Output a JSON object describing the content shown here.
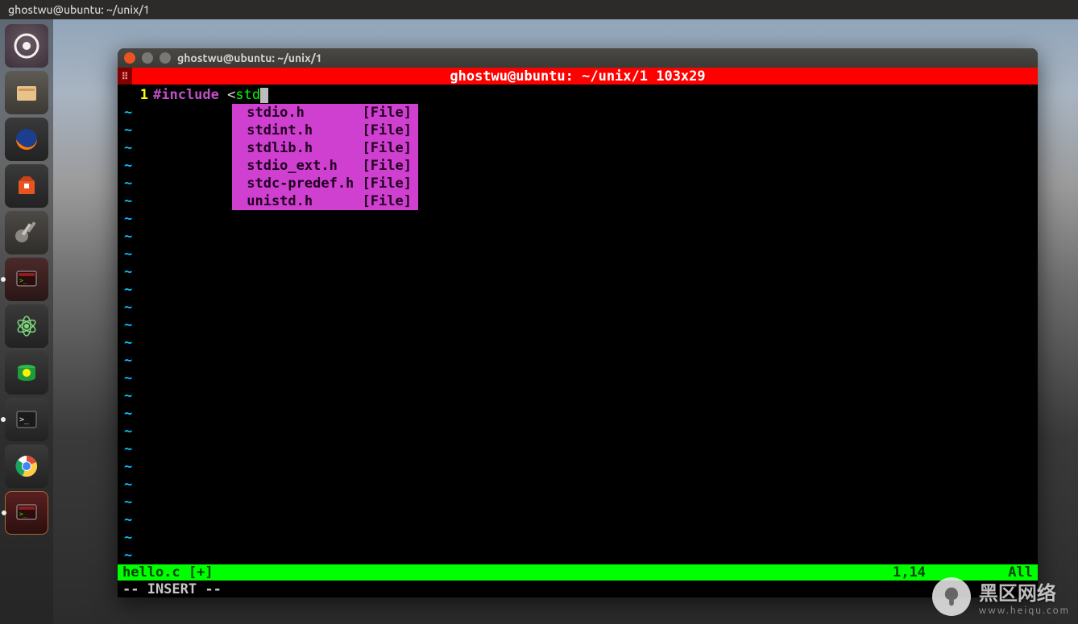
{
  "topbar": {
    "title": "ghostwu@ubuntu: ~/unix/1"
  },
  "launcher": {
    "items": [
      {
        "name": "dash-icon"
      },
      {
        "name": "files-icon"
      },
      {
        "name": "firefox-icon"
      },
      {
        "name": "software-center-icon"
      },
      {
        "name": "settings-icon"
      },
      {
        "name": "terminal-icon",
        "pip": true
      },
      {
        "name": "atom-icon"
      },
      {
        "name": "navicat-icon"
      },
      {
        "name": "terminal2-icon",
        "pip": true
      },
      {
        "name": "chrome-icon"
      },
      {
        "name": "terminal3-icon",
        "pip": true
      }
    ]
  },
  "terminal": {
    "title": "ghostwu@ubuntu: ~/unix/1",
    "ruler_mark": "⠿",
    "ruler_title": "ghostwu@ubuntu: ~/unix/1 103x29",
    "line_number": "1",
    "code_keyword": "#include ",
    "code_lt": "<",
    "code_partial": "std",
    "tilde": "~",
    "tilde_count": 26,
    "popup": [
      {
        "name": "stdio.h",
        "tag": "[File]"
      },
      {
        "name": "stdint.h",
        "tag": "[File]"
      },
      {
        "name": "stdlib.h",
        "tag": "[File]"
      },
      {
        "name": "stdio_ext.h",
        "tag": "[File]"
      },
      {
        "name": "stdc-predef.h",
        "tag": "[File]"
      },
      {
        "name": "unistd.h",
        "tag": "[File]"
      }
    ],
    "status_left": "hello.c [+]",
    "status_right_pos": "1,14",
    "status_right_pct": "All",
    "mode": "-- INSERT --"
  },
  "watermark": {
    "brand": "黑区网络",
    "sub": "www.heiqu.com",
    "mush": "🍄"
  }
}
